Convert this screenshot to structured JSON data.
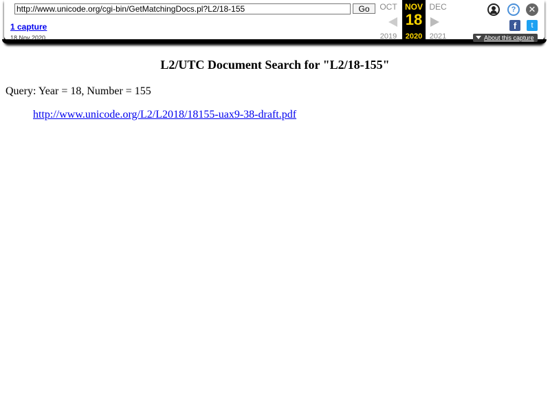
{
  "toolbar": {
    "url": "http://www.unicode.org/cgi-bin/GetMatchingDocs.pl?L2/18-155",
    "go_label": "Go",
    "captures_label": "1 capture",
    "capture_date": "18 Nov 2020",
    "prev_month": "OCT",
    "current_month": "NOV",
    "next_month": "DEC",
    "current_day": "18",
    "prev_year": "2019",
    "current_year": "2020",
    "next_year": "2021",
    "about_label": "About this capture",
    "help_glyph": "?",
    "close_glyph": "✕",
    "facebook_glyph": "f",
    "twitter_glyph": "t"
  },
  "page": {
    "title": "L2/UTC Document Search for \"L2/18-155\"",
    "query": "Query: Year = 18, Number = 155",
    "result_link": "http://www.unicode.org/L2/L2018/18155-uax9-38-draft.pdf"
  },
  "colors": {
    "accent_gold": "#ffd700",
    "link": "#0000ee",
    "facebook": "#3b5998",
    "twitter": "#1da1f2"
  }
}
